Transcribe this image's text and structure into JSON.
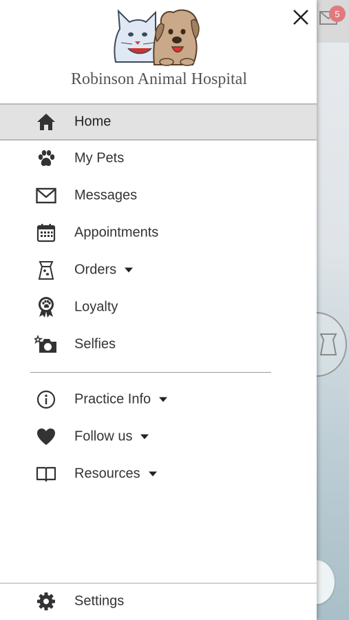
{
  "app": {
    "name": "Robinson Animal Hospital"
  },
  "background": {
    "badge_count": "5"
  },
  "menu": {
    "items": [
      {
        "label": "Home",
        "icon": "home-icon",
        "active": true
      },
      {
        "label": "My Pets",
        "icon": "paw-icon"
      },
      {
        "label": "Messages",
        "icon": "envelope-icon"
      },
      {
        "label": "Appointments",
        "icon": "calendar-icon"
      },
      {
        "label": "Orders",
        "icon": "pet-food-bag-icon",
        "dropdown": true
      },
      {
        "label": "Loyalty",
        "icon": "ribbon-badge-icon"
      },
      {
        "label": "Selfies",
        "icon": "camera-icon"
      }
    ],
    "secondary": [
      {
        "label": "Practice Info",
        "icon": "info-icon",
        "dropdown": true
      },
      {
        "label": "Follow us",
        "icon": "heart-icon",
        "dropdown": true
      },
      {
        "label": "Resources",
        "icon": "book-icon",
        "dropdown": true
      }
    ],
    "settings": {
      "label": "Settings",
      "icon": "gear-icon"
    }
  },
  "colors": {
    "active_bg": "#e2e2e2",
    "text": "#333333",
    "badge": "#e07a7f"
  }
}
